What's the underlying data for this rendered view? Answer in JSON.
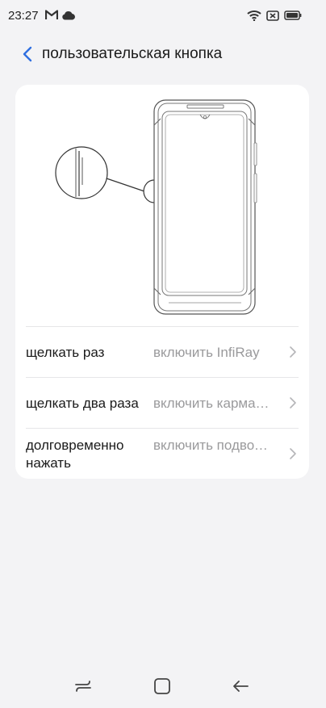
{
  "status_bar": {
    "time": "23:27",
    "left_icons": [
      "gmail-icon",
      "cloud-icon"
    ],
    "right_icons": [
      "wifi-icon",
      "no-sim-icon",
      "battery-icon"
    ]
  },
  "header": {
    "back_icon": "chevron-left-icon",
    "title": "пользовательская кнопка"
  },
  "illustration": {
    "icon": "phone-side-button-illustration"
  },
  "settings": [
    {
      "label": "щелкать раз",
      "value": "включить InfiRay"
    },
    {
      "label": "щелкать два раза",
      "value": "включить карманный фонарик"
    },
    {
      "label": "долговременно нажать",
      "value": "включить подводный режим"
    }
  ],
  "colors": {
    "accent": "#2f6fe0",
    "background": "#f3f3f5",
    "card": "#ffffff",
    "secondary_text": "#9a9a9c"
  },
  "nav_bar": {
    "items": [
      "recent-apps-icon",
      "home-icon",
      "back-arrow-icon"
    ]
  }
}
